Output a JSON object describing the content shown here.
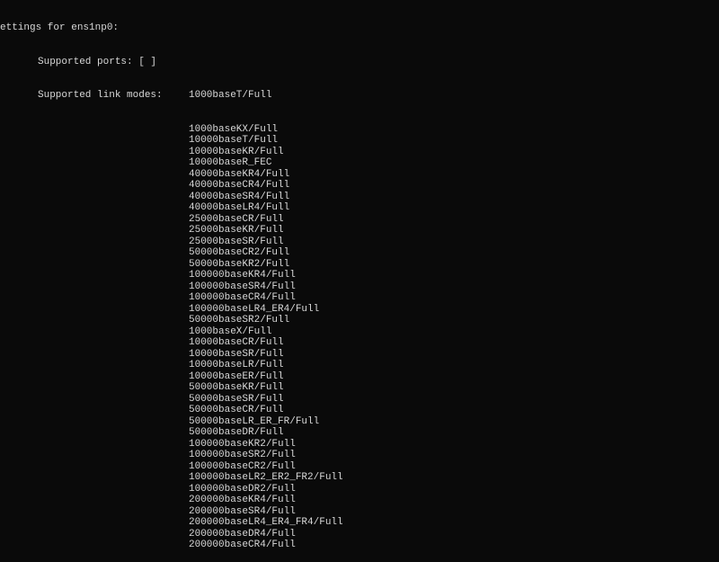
{
  "header": "ettings for ens1np0:",
  "supported_ports_label": "Supported ports: [ ]",
  "supported_link_modes_label": "Supported link modes:",
  "link_modes": [
    "1000baseT/Full",
    "1000baseKX/Full",
    "10000baseT/Full",
    "10000baseKR/Full",
    "10000baseR_FEC",
    "40000baseKR4/Full",
    "40000baseCR4/Full",
    "40000baseSR4/Full",
    "40000baseLR4/Full",
    "25000baseCR/Full",
    "25000baseKR/Full",
    "25000baseSR/Full",
    "50000baseCR2/Full",
    "50000baseKR2/Full",
    "100000baseKR4/Full",
    "100000baseSR4/Full",
    "100000baseCR4/Full",
    "100000baseLR4_ER4/Full",
    "50000baseSR2/Full",
    "1000baseX/Full",
    "10000baseCR/Full",
    "10000baseSR/Full",
    "10000baseLR/Full",
    "10000baseER/Full",
    "50000baseKR/Full",
    "50000baseSR/Full",
    "50000baseCR/Full",
    "50000baseLR_ER_FR/Full",
    "50000baseDR/Full",
    "100000baseKR2/Full",
    "100000baseSR2/Full",
    "100000baseCR2/Full",
    "100000baseLR2_ER2_FR2/Full",
    "100000baseDR2/Full",
    "200000baseKR4/Full",
    "200000baseSR4/Full",
    "200000baseLR4_ER4_FR4/Full",
    "200000baseDR4/Full",
    "200000baseCR4/Full"
  ]
}
